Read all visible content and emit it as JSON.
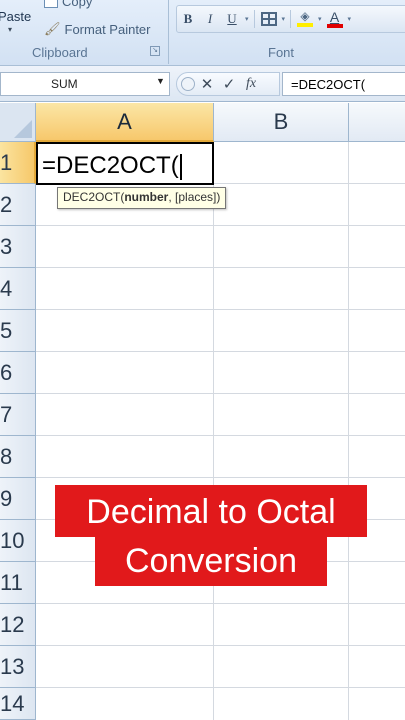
{
  "ribbon": {
    "clipboard": {
      "paste_label": "Paste",
      "copy_label": "Copy",
      "format_painter_label": "Format Painter",
      "group_label": "Clipboard"
    },
    "font": {
      "group_label": "Font",
      "bold_glyph": "B",
      "italic_glyph": "I",
      "underline_glyph": "U",
      "font_color_glyph": "A",
      "fill_color": "#ffee00",
      "font_color": "#e00000"
    }
  },
  "formula_bar": {
    "name_box": "SUM",
    "cancel_glyph": "✕",
    "enter_glyph": "✓",
    "fx_glyph": "fx",
    "formula": "=DEC2OCT("
  },
  "grid": {
    "columns": [
      "A",
      "B"
    ],
    "rows": [
      "1",
      "2",
      "3",
      "4",
      "5",
      "6",
      "7",
      "8",
      "9",
      "10",
      "11",
      "12",
      "13",
      "14"
    ],
    "active_cell": {
      "content": "=DEC2OCT("
    },
    "tooltip": {
      "function": "DEC2OCT(",
      "arg1": "number",
      "rest": ", [places])"
    }
  },
  "caption": {
    "line1": "Decimal to Octal",
    "line2": "Conversion",
    "background": "#e1191b"
  }
}
